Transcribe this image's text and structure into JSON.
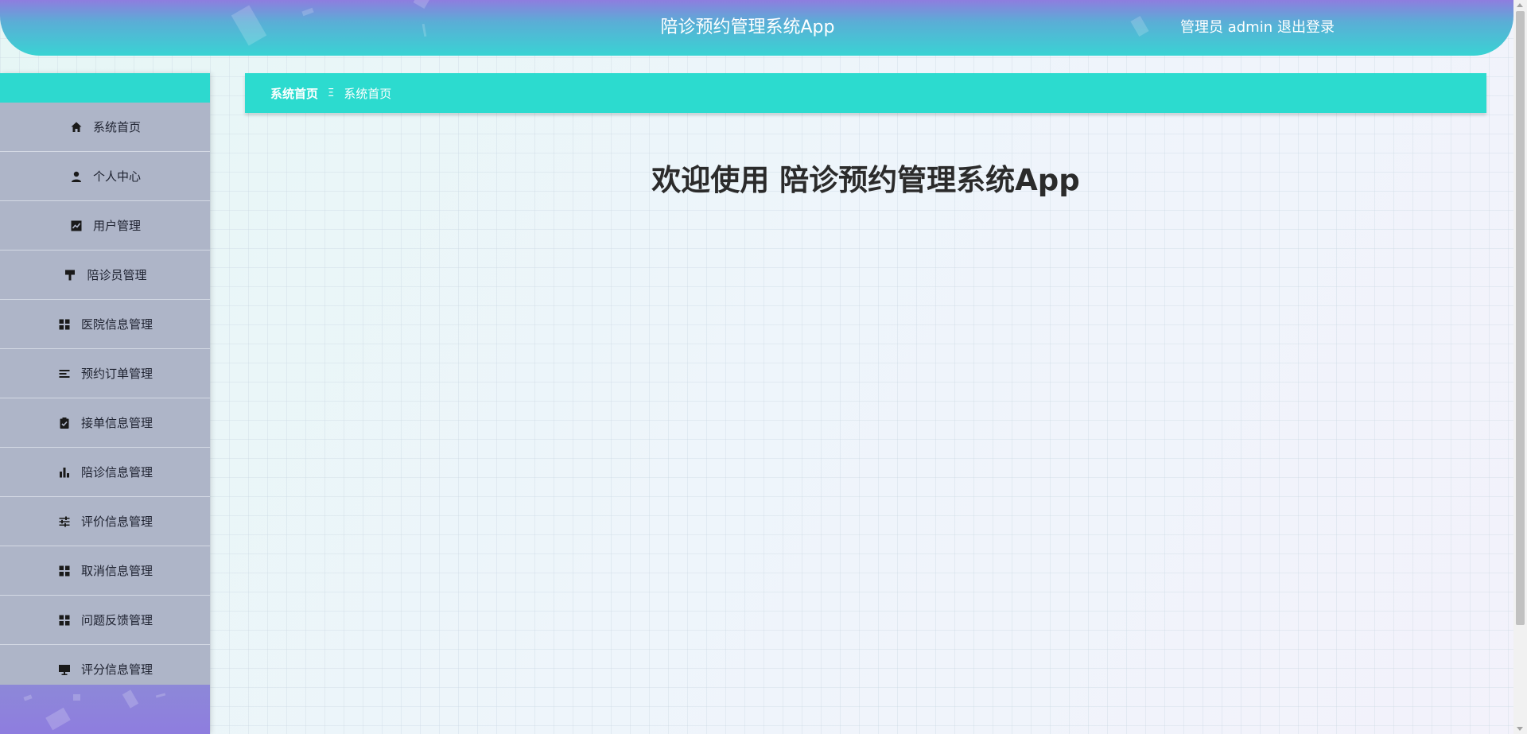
{
  "header": {
    "title": "陪诊预约管理系统App",
    "user_label": "管理员 admin",
    "logout_label": "退出登录"
  },
  "sidebar": {
    "items": [
      {
        "label": "系统首页",
        "icon": "home-icon"
      },
      {
        "label": "个人中心",
        "icon": "person-icon"
      },
      {
        "label": "用户管理",
        "icon": "chart-line-icon"
      },
      {
        "label": "陪诊员管理",
        "icon": "paint-roller-icon"
      },
      {
        "label": "医院信息管理",
        "icon": "grid-icon"
      },
      {
        "label": "预约订单管理",
        "icon": "list-icon"
      },
      {
        "label": "接单信息管理",
        "icon": "clipboard-check-icon"
      },
      {
        "label": "陪诊信息管理",
        "icon": "bar-chart-icon"
      },
      {
        "label": "评价信息管理",
        "icon": "sliders-icon"
      },
      {
        "label": "取消信息管理",
        "icon": "grid-icon"
      },
      {
        "label": "问题反馈管理",
        "icon": "grid-icon"
      },
      {
        "label": "评分信息管理",
        "icon": "monitor-icon"
      }
    ]
  },
  "breadcrumb": {
    "home": "系统首页",
    "separator": "Ξ",
    "current": "系统首页"
  },
  "main": {
    "welcome": "欢迎使用 陪诊预约管理系统App"
  },
  "colors": {
    "accent": "#2cdbcf",
    "header_top": "#8e7ddf",
    "sidebar_bg": "#aeb5c8"
  }
}
